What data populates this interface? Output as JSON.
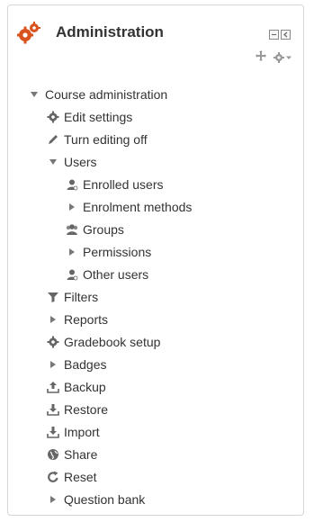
{
  "header": {
    "title": "Administration"
  },
  "colors": {
    "logo": "#d9531e",
    "icon": "#666666",
    "text": "#333333",
    "caret": "#777777"
  },
  "tree": [
    {
      "label": "Course administration",
      "icon": "caret-down-icon"
    },
    {
      "label": "Edit settings",
      "icon": "gear-icon"
    },
    {
      "label": "Turn editing off",
      "icon": "pencil-icon"
    },
    {
      "label": "Users",
      "icon": "caret-down-icon"
    },
    {
      "label": "Enrolled users",
      "icon": "user-icon"
    },
    {
      "label": "Enrolment methods",
      "icon": "caret-right-icon"
    },
    {
      "label": "Groups",
      "icon": "users-icon"
    },
    {
      "label": "Permissions",
      "icon": "caret-right-icon"
    },
    {
      "label": "Other users",
      "icon": "user-icon"
    },
    {
      "label": "Filters",
      "icon": "filter-icon"
    },
    {
      "label": "Reports",
      "icon": "caret-right-icon"
    },
    {
      "label": "Gradebook setup",
      "icon": "gear-icon"
    },
    {
      "label": "Badges",
      "icon": "caret-right-icon"
    },
    {
      "label": "Backup",
      "icon": "upload-icon"
    },
    {
      "label": "Restore",
      "icon": "download-icon"
    },
    {
      "label": "Import",
      "icon": "download-icon"
    },
    {
      "label": "Share",
      "icon": "globe-icon"
    },
    {
      "label": "Reset",
      "icon": "reset-icon"
    },
    {
      "label": "Question bank",
      "icon": "caret-right-icon"
    }
  ]
}
